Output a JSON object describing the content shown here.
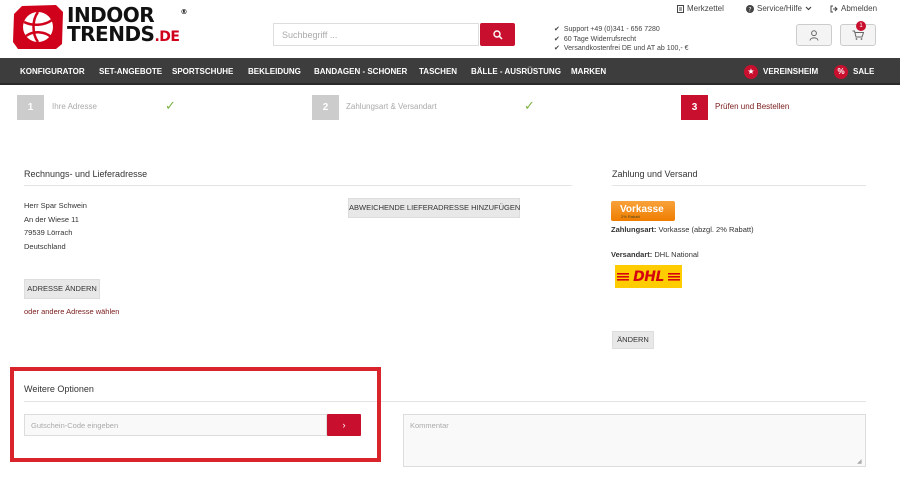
{
  "brand": {
    "line1": "INDOOR",
    "line2": "TRENDS",
    "tld": ".DE",
    "reg": "®",
    "colors": {
      "red": "#c8102e",
      "nav": "#3d3d3d",
      "orange": "#ef7d00",
      "dhl_yellow": "#ffcc00",
      "check_green": "#7cb342"
    }
  },
  "header": {
    "search_placeholder": "Suchbegriff ...",
    "usps": [
      "Support +49 (0)341 - 656 7280",
      "60 Tage Widerrufsrecht",
      "Versandkostenfrei DE und AT ab 100,- €"
    ],
    "top_links": {
      "merkzettel": "Merkzettel",
      "service": "Service/Hilfe",
      "abmelden": "Abmelden"
    },
    "cart_count": "1"
  },
  "nav": {
    "items": [
      "KONFIGURATOR",
      "SET-ANGEBOTE",
      "SPORTSCHUHE",
      "BEKLEIDUNG",
      "BANDAGEN - SCHONER",
      "TASCHEN",
      "BÄLLE - AUSRÜSTUNG",
      "MARKEN"
    ],
    "vereinsheim": "VEREINSHEIM",
    "sale": "SALE",
    "sale_symbol": "%"
  },
  "steps": [
    {
      "num": "1",
      "label": "Ihre Adresse"
    },
    {
      "num": "2",
      "label": "Zahlungsart & Versandart"
    },
    {
      "num": "3",
      "label": "Prüfen und Bestellen"
    }
  ],
  "address": {
    "title": "Rechnungs- und Lieferadresse",
    "lines": [
      "Herr Spar Schwein",
      "An der Wiese 11",
      "79539 Lörrach",
      "Deutschland"
    ],
    "add_shipping_btn": "ABWEICHENDE LIEFERADRESSE HINZUFÜGEN",
    "change_btn": "ADRESSE ÄNDERN",
    "other_link": "oder andere Adresse wählen"
  },
  "payment": {
    "title": "Zahlung und Versand",
    "vorkasse_logo": "Vorkasse",
    "vorkasse_sub": "2% Rabatt",
    "zahlungsart_label": "Zahlungsart:",
    "zahlungsart_value": "Vorkasse (abzgl. 2% Rabatt)",
    "versandart_label": "Versandart:",
    "versandart_value": "DHL National",
    "dhl_logo": "DHL",
    "change_btn": "ÄNDERN"
  },
  "options": {
    "title": "Weitere Optionen",
    "voucher_placeholder": "Gutschein-Code eingeben",
    "voucher_btn": "›",
    "comment_placeholder": "Kommentar"
  }
}
